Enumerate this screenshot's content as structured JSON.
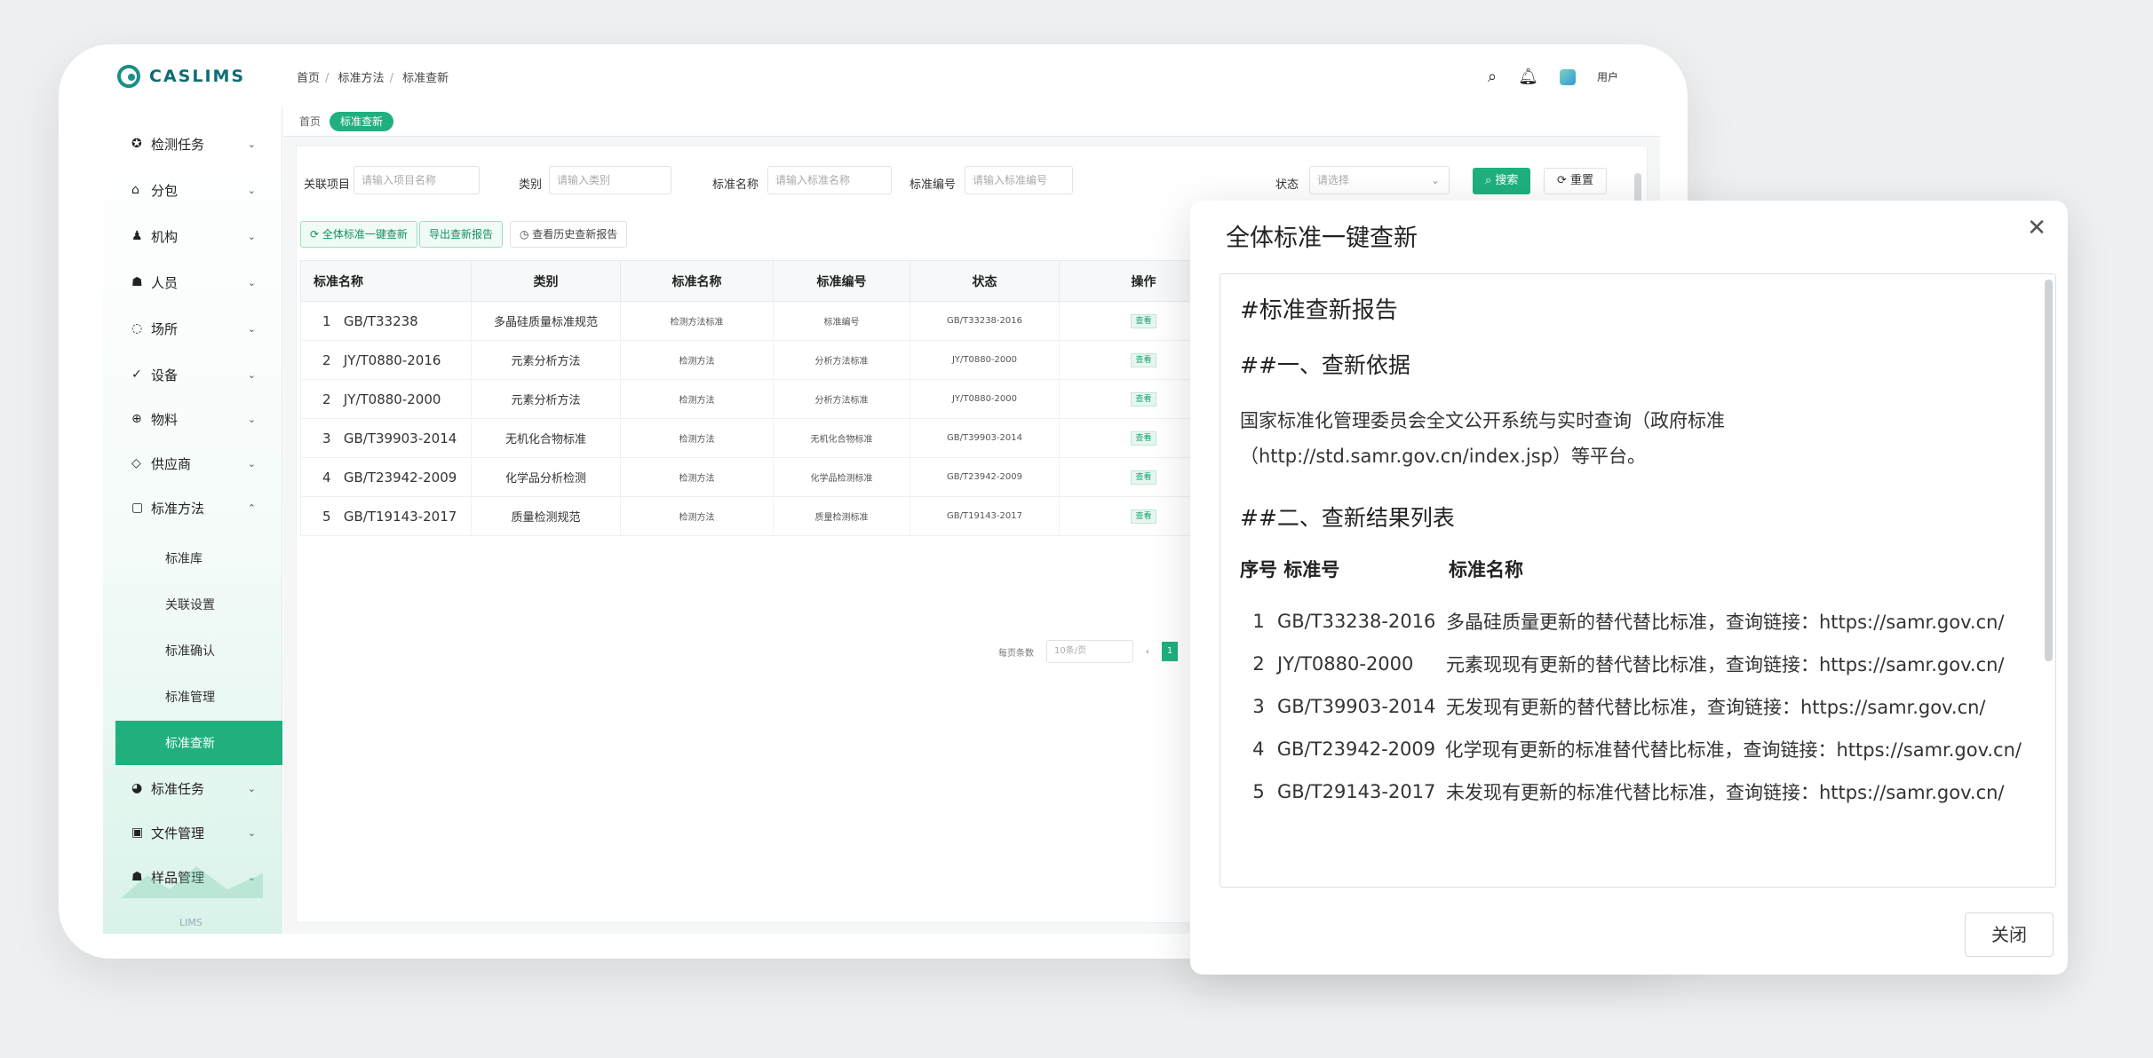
{
  "app": {
    "logo_text": "CASLIMS"
  },
  "breadcrumb": [
    "首页",
    "标准方法",
    "标准查新"
  ],
  "topbar": {
    "user": "用户"
  },
  "sidebar": {
    "items": [
      {
        "label": "检测任务",
        "icon": "task-icon"
      },
      {
        "label": "分包",
        "icon": "home-icon"
      },
      {
        "label": "机构",
        "icon": "org-icon"
      },
      {
        "label": "人员",
        "icon": "person-icon"
      },
      {
        "label": "场所",
        "icon": "location-icon"
      },
      {
        "label": "设备",
        "icon": "check-icon"
      },
      {
        "label": "物料",
        "icon": "material-icon"
      },
      {
        "label": "供应商",
        "icon": "supplier-icon"
      },
      {
        "label": "标准方法",
        "icon": "document-icon"
      }
    ],
    "sub_items": [
      "标准库",
      "关联设置",
      "标准确认",
      "标准管理",
      "标准查新"
    ],
    "bottom_items": [
      {
        "label": "标准任务",
        "icon": "globe-icon"
      },
      {
        "label": "文件管理",
        "icon": "file-icon"
      },
      {
        "label": "样品管理",
        "icon": "sample-icon"
      }
    ],
    "footer": "LIMS"
  },
  "tabs": [
    "首页",
    "标准查新"
  ],
  "filters": {
    "labels": [
      "关联项目",
      "类别",
      "标准名称",
      "标准编号",
      "状态"
    ],
    "placeholders": [
      "请输入项目名称",
      "请输入类别",
      "请输入标准名称",
      "请输入标准编号",
      "请选择"
    ],
    "search": "搜索",
    "reset": "重置"
  },
  "actions": [
    "全体标准一键查新",
    "导出查新报告",
    "查看历史查新报告"
  ],
  "table": {
    "headers": [
      "标准名称",
      "类别",
      "标准名称",
      "标准编号",
      "状态",
      "操作"
    ],
    "rows": [
      {
        "idx": "1",
        "code": "GB/T33238",
        "name": "多晶硅质量标准规范",
        "cat": "检测方法标准",
        "num": "标准编号",
        "status": "GB/T33238-2016",
        "op": "查看"
      },
      {
        "idx": "2",
        "code": "JY/T0880-2016",
        "name": "元素分析方法",
        "cat": "检测方法",
        "num": "分析方法标准",
        "status": "JY/T0880-2000",
        "op": "查看"
      },
      {
        "idx": "2",
        "code": "JY/T0880-2000",
        "name": "元素分析方法",
        "cat": "检测方法",
        "num": "分析方法标准",
        "status": "JY/T0880-2000",
        "op": "查看"
      },
      {
        "idx": "3",
        "code": "GB/T39903-2014",
        "name": "无机化合物标准",
        "cat": "检测方法",
        "num": "无机化合物标准",
        "status": "GB/T39903-2014",
        "op": "查看"
      },
      {
        "idx": "4",
        "code": "GB/T23942-2009",
        "name": "化学品分析检测",
        "cat": "检测方法",
        "num": "化学品检测标准",
        "status": "GB/T23942-2009",
        "op": "查看"
      },
      {
        "idx": "5",
        "code": "GB/T19143-2017",
        "name": "质量检测规范",
        "cat": "检测方法",
        "num": "质量检测标准",
        "status": "GB/T19143-2017",
        "op": "查看"
      }
    ]
  },
  "pager": {
    "label": "每页条数",
    "select": "10条/页",
    "prev": "‹",
    "current": "1"
  },
  "modal": {
    "title": "全体标准一键查新",
    "close_button": "关闭",
    "report": {
      "h1": "#标准查新报告",
      "h2_basis": "##一、查新依据",
      "basis_text": "国家标准化管理委员会全文公开系统与实时查询（政府标准（http://std.samr.gov.cn/index.jsp）等平台。",
      "h2_results": "##二、查新结果列表",
      "col_headers": [
        "序号 标准号",
        "标准名称"
      ],
      "rows": [
        {
          "n": "1",
          "code": "GB/T33238-2016",
          "text": "多晶硅质量更新的替代替比标准，查询链接：https://samr.gov.cn/"
        },
        {
          "n": "2",
          "code": "JY/T0880-2000",
          "text": "元素现现有更新的替代替比标准，查询链接：https://samr.gov.cn/"
        },
        {
          "n": "3",
          "code": "GB/T39903-2014",
          "text": "无发现有更新的替代替比标准，查询链接：https://samr.gov.cn/"
        },
        {
          "n": "4",
          "code": "GB/T23942-2009",
          "text": "化学现有更新的标准替代替比标准，查询链接：https://samr.gov.cn/"
        },
        {
          "n": "5",
          "code": "GB/T29143-2017",
          "text": "未发现有更新的标准代替比标准，查询链接：https://samr.gov.cn/"
        }
      ]
    }
  }
}
